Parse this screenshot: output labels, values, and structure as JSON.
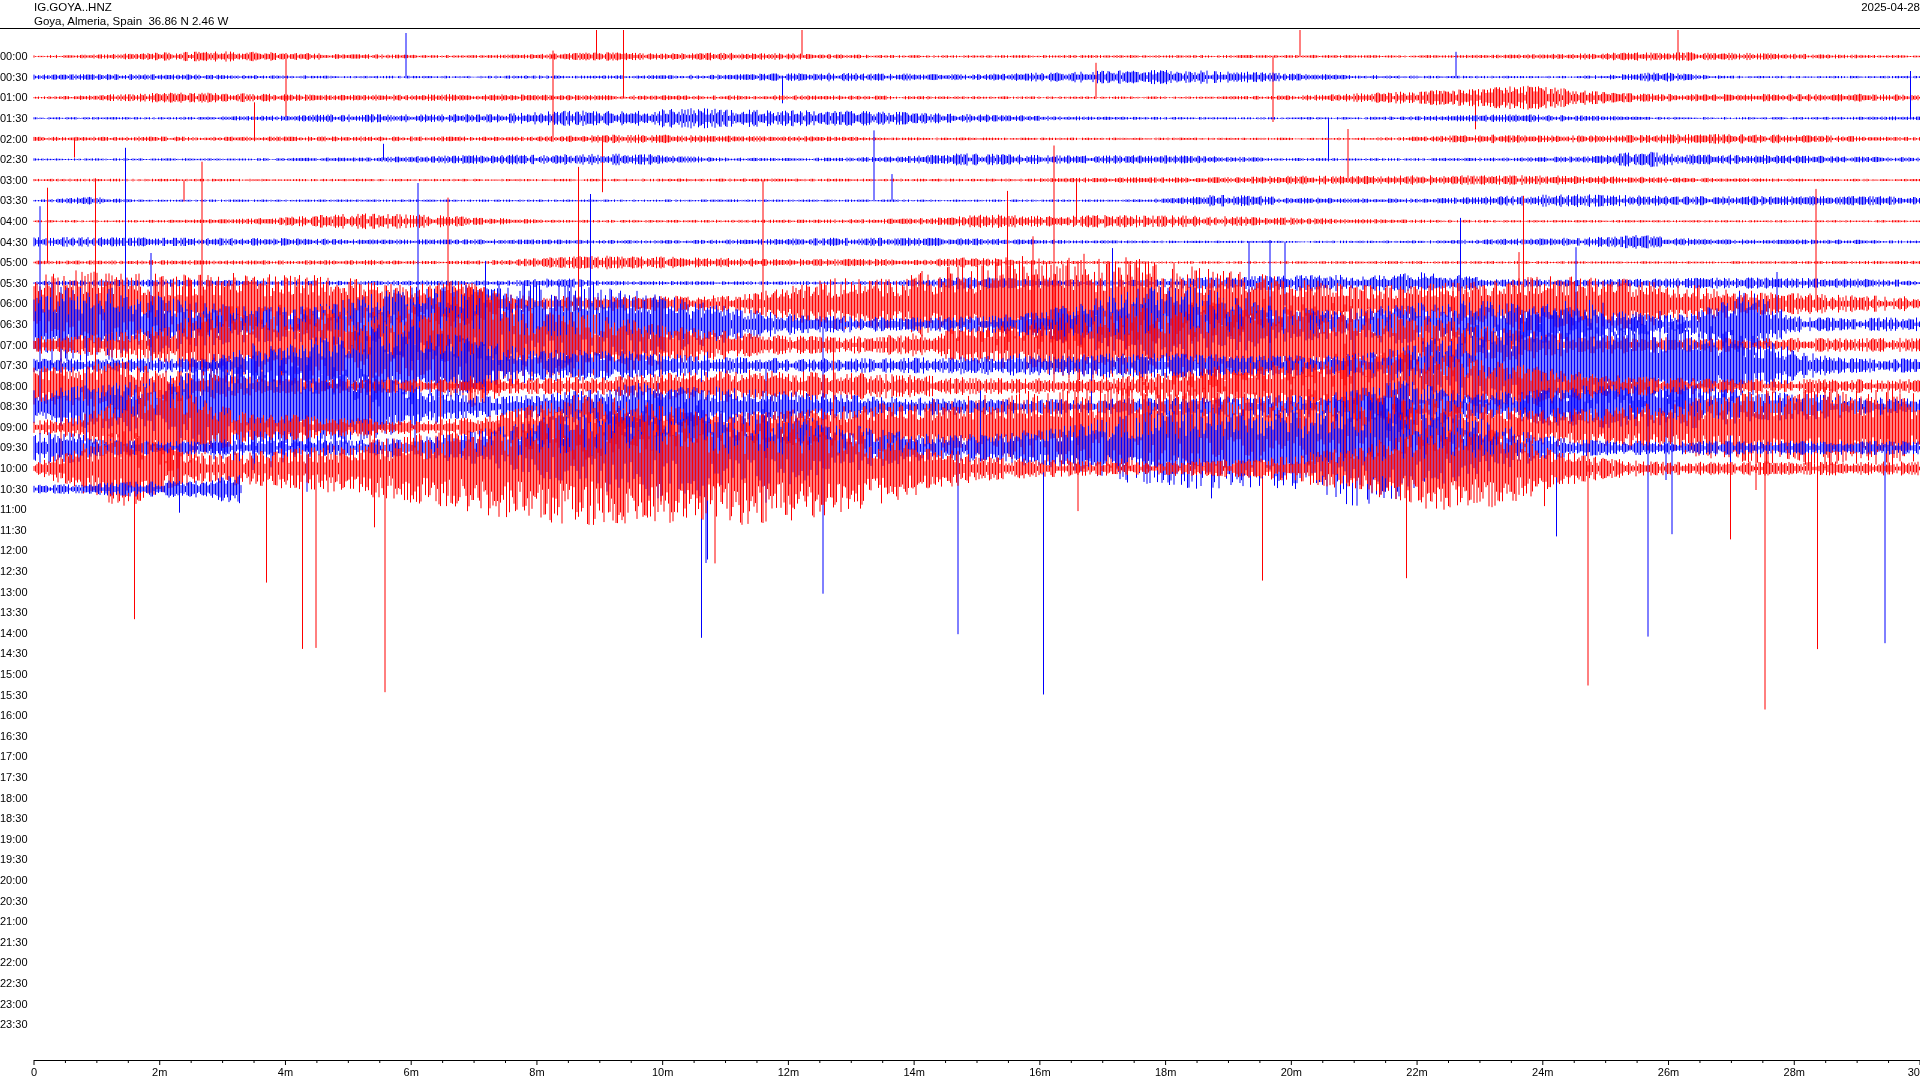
{
  "header": {
    "station": "IG.GOYA..HNZ",
    "location": "Goya, Almeria, Spain  36.86 N 2.46 W",
    "date": "2025-04-28"
  },
  "rows": [
    {
      "label": "00:00"
    },
    {
      "label": "00:30"
    },
    {
      "label": "01:00"
    },
    {
      "label": "01:30"
    },
    {
      "label": "02:00"
    },
    {
      "label": "02:30"
    },
    {
      "label": "03:00"
    },
    {
      "label": "03:30"
    },
    {
      "label": "04:00"
    },
    {
      "label": "04:30"
    },
    {
      "label": "05:00"
    },
    {
      "label": "05:30"
    },
    {
      "label": "06:00"
    },
    {
      "label": "06:30"
    },
    {
      "label": "07:00"
    },
    {
      "label": "07:30"
    },
    {
      "label": "08:00"
    },
    {
      "label": "08:30"
    },
    {
      "label": "09:00"
    },
    {
      "label": "09:30"
    },
    {
      "label": "10:00"
    },
    {
      "label": "10:30"
    },
    {
      "label": "11:00"
    },
    {
      "label": "11:30"
    },
    {
      "label": "12:00"
    },
    {
      "label": "12:30"
    },
    {
      "label": "13:00"
    },
    {
      "label": "13:30"
    },
    {
      "label": "14:00"
    },
    {
      "label": "14:30"
    },
    {
      "label": "15:00"
    },
    {
      "label": "15:30"
    },
    {
      "label": "16:00"
    },
    {
      "label": "16:30"
    },
    {
      "label": "17:00"
    },
    {
      "label": "17:30"
    },
    {
      "label": "18:00"
    },
    {
      "label": "18:30"
    },
    {
      "label": "19:00"
    },
    {
      "label": "19:30"
    },
    {
      "label": "20:00"
    },
    {
      "label": "20:30"
    },
    {
      "label": "21:00"
    },
    {
      "label": "21:30"
    },
    {
      "label": "22:00"
    },
    {
      "label": "22:30"
    },
    {
      "label": "23:00"
    },
    {
      "label": "23:30"
    }
  ],
  "x_axis": {
    "labels": [
      "0",
      "2m",
      "4m",
      "6m",
      "8m",
      "10m",
      "12m",
      "14m",
      "16m",
      "18m",
      "20m",
      "22m",
      "24m",
      "26m",
      "28m",
      "30"
    ]
  }
}
